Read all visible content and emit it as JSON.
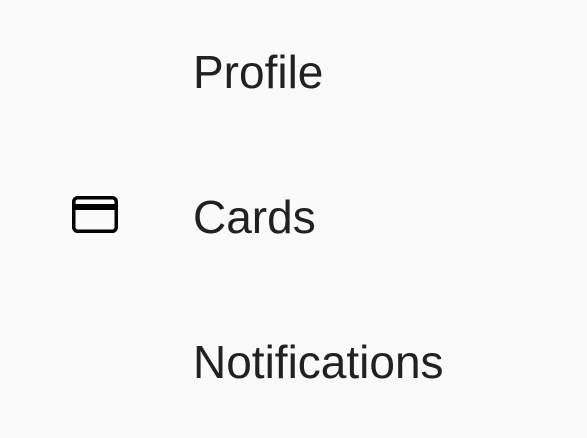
{
  "menu": {
    "items": [
      {
        "label": "Profile",
        "icon": ""
      },
      {
        "label": "Cards",
        "icon": "credit-card-icon"
      },
      {
        "label": "Notifications",
        "icon": ""
      }
    ]
  }
}
